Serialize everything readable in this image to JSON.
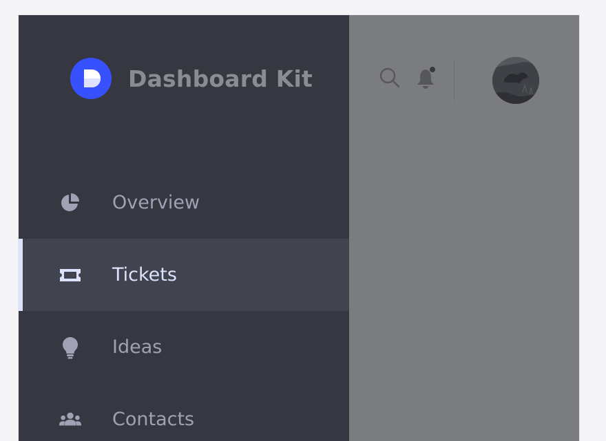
{
  "app": {
    "title": "Dashboard Kit",
    "logo_letter": "D",
    "accent_color": "#3751ff"
  },
  "sidebar": {
    "items": [
      {
        "label": "Overview",
        "icon": "pie-chart-icon",
        "active": false
      },
      {
        "label": "Tickets",
        "icon": "ticket-icon",
        "active": true
      },
      {
        "label": "Ideas",
        "icon": "lightbulb-icon",
        "active": false
      },
      {
        "label": "Contacts",
        "icon": "users-icon",
        "active": false
      }
    ]
  },
  "header": {
    "search_icon": "search-icon",
    "notification_icon": "bell-icon",
    "has_unread_notifications": true,
    "avatar": "user-avatar"
  }
}
